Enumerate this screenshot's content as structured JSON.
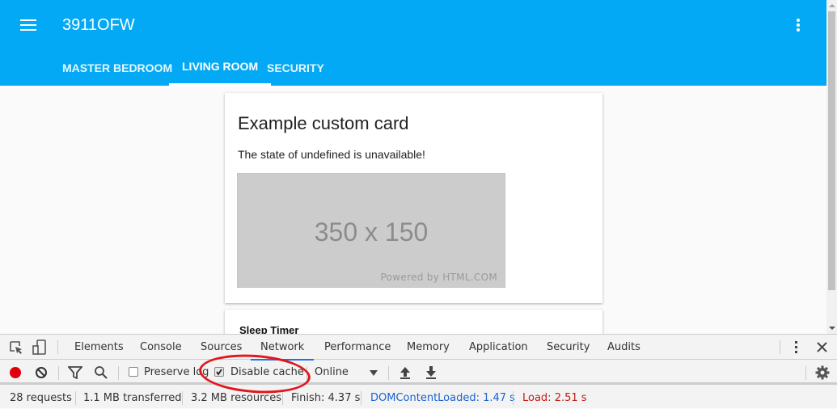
{
  "header": {
    "title": "3911OFW",
    "tabs": [
      {
        "label": "MASTER BEDROOM"
      },
      {
        "label": "LIVING ROOM",
        "active": true
      },
      {
        "label": "SECURITY"
      }
    ],
    "color": "#03a9f4"
  },
  "card": {
    "title": "Example custom card",
    "text": "The state of undefined is unavailable!",
    "image_text": "350 x 150",
    "image_credit": "Powered by HTML.COM"
  },
  "card2": {
    "title": "Sleep Timer"
  },
  "devtools": {
    "tabs": [
      "Elements",
      "Console",
      "Sources",
      "Network",
      "Performance",
      "Memory",
      "Application",
      "Security",
      "Audits"
    ],
    "active_tab": "Network",
    "toolbar": {
      "preserve_log": "Preserve log",
      "preserve_log_checked": false,
      "disable_cache": "Disable cache",
      "disable_cache_checked": true,
      "throttle": "Online"
    },
    "status": {
      "requests": "28 requests",
      "transferred": "1.1 MB transferred",
      "resources": "3.2 MB resources",
      "finish": "Finish: 4.37 s",
      "dom": "DOMContentLoaded: 1.47 s",
      "load": "Load: 2.51 s"
    }
  }
}
